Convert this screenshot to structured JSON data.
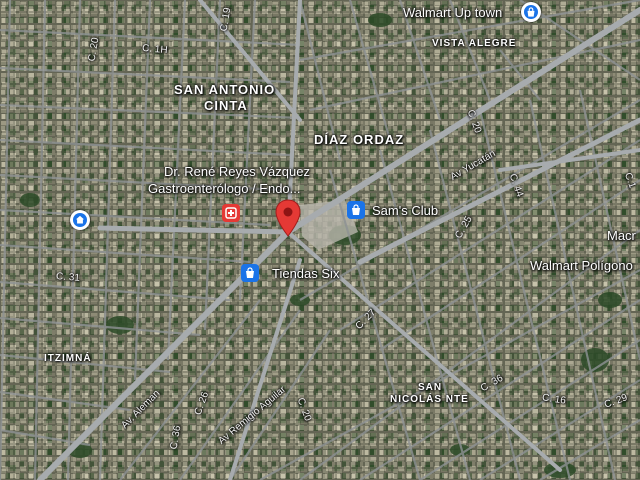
{
  "areas": {
    "san_antonio_1": "SAN ANTONIO",
    "san_antonio_2": "CINTA",
    "diaz_ordaz": "DÍAZ ORDAZ",
    "itzimna": "ITZIMNÁ",
    "vista_alegre": "VISTA ALEGRE",
    "san_nicolas_1": "SAN",
    "san_nicolas_2": "NICOLÁS NTE"
  },
  "pois": {
    "walmart_uptown": "Walmart Up town",
    "sams_club": "Sam's Club",
    "tiendas_six": "Tiendas Six",
    "doctor_line1": "Dr. René Reyes Vázquez",
    "doctor_line2": "Gastroenterólogo / Endo...",
    "macro": "Macr",
    "walmart_poligono": "Walmart Polígono"
  },
  "streets": {
    "c20_a": "C. 20",
    "c1h": "C. 1H",
    "c19": "C. 19",
    "c31": "C. 31",
    "c20_b": "C. 20",
    "av_yucatan": "Av Yucatán",
    "c44": "C. 44",
    "c25": "C. 25",
    "c27": "C. 27",
    "c36_a": "C. 36",
    "c16": "C. 16",
    "c29": "C. 29",
    "av_aleman": "Av. Aleman",
    "c26": "C. 26",
    "av_remigio": "Av Remigio Aguilar",
    "c20_c": "C. 20",
    "c36_b": "C. 36",
    "c1_edge": "C.1"
  },
  "colors": {
    "pin_red": "#e53935",
    "hospital_red": "#e53935",
    "shop_blue": "#1a73e8",
    "home_blue": "#1a73e8",
    "road": "#9aa0a6"
  },
  "icons": {
    "selected_pin": "map-pin-icon",
    "hospital": "hospital-icon",
    "shopping": "shopping-bag-icon",
    "home": "home-icon"
  }
}
